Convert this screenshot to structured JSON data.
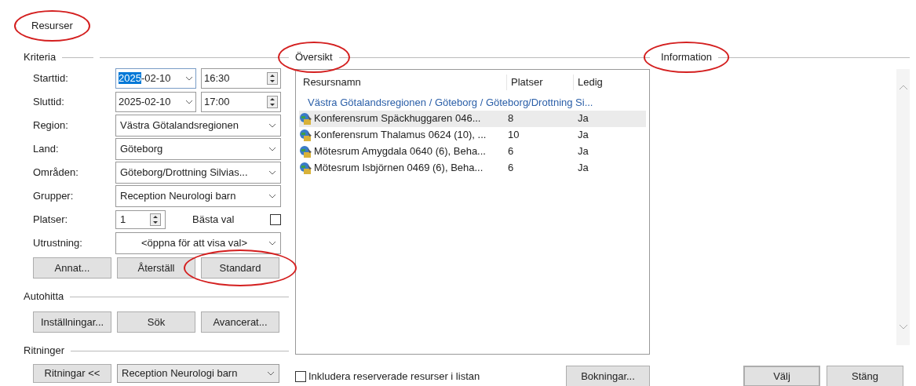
{
  "title": {
    "text": "Resurser",
    "circled": true
  },
  "criteria": {
    "heading": {
      "text": "Kriteria"
    },
    "fields": [
      {
        "kind": "datetime",
        "label": "Starttid:",
        "date_parts": [
          {
            "text": "2025",
            "selected": true
          },
          {
            "text": "-02-10",
            "selected": false
          }
        ],
        "time": "16:30"
      },
      {
        "kind": "datetime",
        "label": "Sluttid:",
        "date_parts": [
          {
            "text": "2025-02-10",
            "selected": false
          }
        ],
        "time": "17:00"
      },
      {
        "kind": "combo",
        "label": "Region:",
        "value": "Västra Götalandsregionen"
      },
      {
        "kind": "combo",
        "label": "Land:",
        "value": "Göteborg"
      },
      {
        "kind": "combo",
        "label": "Områden:",
        "value": "Göteborg/Drottning Silvias..."
      },
      {
        "kind": "combo",
        "label": "Grupper:",
        "value": "Reception Neurologi barn"
      },
      {
        "kind": "spin",
        "label": "Platser:",
        "value": "1",
        "checkbox_label": "Bästa val",
        "checked": false
      },
      {
        "kind": "combo",
        "label": "Utrustning:",
        "placeholder": "<öppna för att visa val>"
      }
    ],
    "buttons": [
      {
        "label": "Annat...",
        "circled": false
      },
      {
        "label": "Återställ",
        "circled": false
      },
      {
        "label": "Standard",
        "circled": true
      }
    ]
  },
  "autohitta": {
    "heading": {
      "text": "Autohitta"
    },
    "buttons": [
      {
        "label": "Inställningar...",
        "circled": false
      },
      {
        "label": "Sök",
        "circled": false
      },
      {
        "label": "Avancerat...",
        "circled": false
      }
    ]
  },
  "ritninger": {
    "heading": {
      "text": "Ritninger"
    },
    "button": "Ritningar <<",
    "combo": "Reception Neurologi barn"
  },
  "overview": {
    "heading": {
      "text": "Översikt",
      "circled": true
    },
    "columns": [
      "Resursnamn",
      "Platser",
      "Ledig"
    ],
    "group": "Västra Götalandsregionen / Göteborg / Göteborg/Drottning Si...",
    "rows": [
      {
        "name": "Konferensrum Späckhuggaren 046...",
        "platser": "8",
        "ledig": "Ja",
        "selected": true
      },
      {
        "name": "Konferensrum Thalamus 0624 (10), ...",
        "platser": "10",
        "ledig": "Ja",
        "selected": false
      },
      {
        "name": "Mötesrum Amygdala 0640 (6), Beha...",
        "platser": "6",
        "ledig": "Ja",
        "selected": false
      },
      {
        "name": "Mötesrum Isbjörnen 0469 (6), Beha...",
        "platser": "6",
        "ledig": "Ja",
        "selected": false
      }
    ],
    "include_reserved": {
      "label": "Inkludera reserverade resurser i listan",
      "checked": false
    },
    "bookings_button": "Bokningar..."
  },
  "information": {
    "heading": {
      "text": "Information",
      "circled": true
    }
  },
  "dialog_buttons": [
    {
      "label": "Välj",
      "default": true
    },
    {
      "label": "Stäng",
      "default": false
    }
  ]
}
